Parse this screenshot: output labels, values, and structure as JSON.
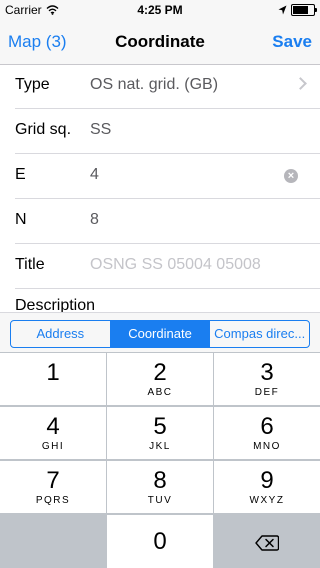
{
  "status_bar": {
    "carrier": "Carrier",
    "time": "4:25 PM",
    "icons": [
      "wifi-icon",
      "location-arrow-icon",
      "battery-icon"
    ],
    "battery_level": 0.85
  },
  "nav": {
    "back_label": "Map (3)",
    "title": "Coordinate",
    "save_label": "Save"
  },
  "form": {
    "rows": [
      {
        "label": "Type",
        "value": "OS nat. grid. (GB)",
        "accessory": "chevron-right-icon"
      },
      {
        "label": "Grid sq.",
        "value": "SS"
      },
      {
        "label": "E",
        "value": "4",
        "accessory": "clear-icon"
      },
      {
        "label": "N",
        "value": "8"
      },
      {
        "label": "Title",
        "placeholder": "OSNG  SS 05004 05008"
      }
    ],
    "description_label": "Description"
  },
  "segments": {
    "items": [
      "Address",
      "Coordinate",
      "Compas direc..."
    ],
    "selected": "Coordinate"
  },
  "keypad": {
    "keys": [
      {
        "num": "1",
        "letters": ""
      },
      {
        "num": "2",
        "letters": "ABC"
      },
      {
        "num": "3",
        "letters": "DEF"
      },
      {
        "num": "4",
        "letters": "GHI"
      },
      {
        "num": "5",
        "letters": "JKL"
      },
      {
        "num": "6",
        "letters": "MNO"
      },
      {
        "num": "7",
        "letters": "PQRS"
      },
      {
        "num": "8",
        "letters": "TUV"
      },
      {
        "num": "9",
        "letters": "WXYZ"
      },
      {
        "num": "0",
        "letters": ""
      }
    ],
    "delete_icon": "backspace-icon"
  },
  "colors": {
    "accent": "#1a7ef0",
    "keypad_bg": "#bfc4ca"
  }
}
